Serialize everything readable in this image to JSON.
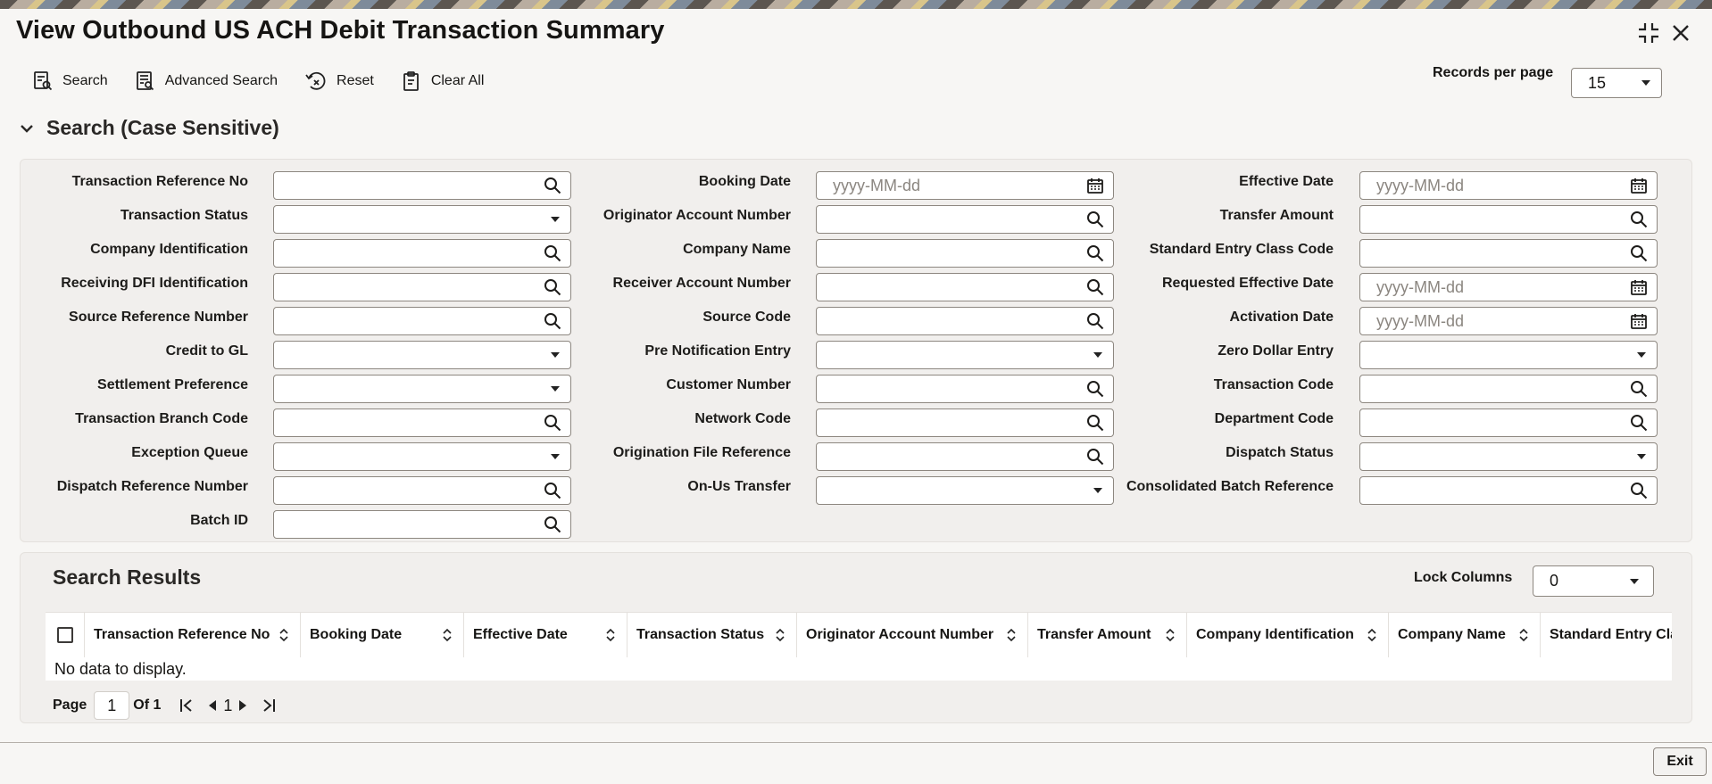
{
  "window": {
    "title": "View Outbound US ACH Debit Transaction Summary"
  },
  "toolbar": {
    "search": "Search",
    "advanced_search": "Advanced Search",
    "reset": "Reset",
    "clear_all": "Clear All",
    "records_per_page_label": "Records per page",
    "records_per_page_value": "15"
  },
  "search_section": {
    "title": "Search (Case Sensitive)"
  },
  "fields": {
    "transaction_reference_no": {
      "label": "Transaction Reference No"
    },
    "transaction_status": {
      "label": "Transaction Status"
    },
    "company_identification": {
      "label": "Company Identification"
    },
    "receiving_dfi_identification": {
      "label": "Receiving DFI Identification"
    },
    "source_reference_number": {
      "label": "Source Reference Number"
    },
    "credit_to_gl": {
      "label": "Credit to GL"
    },
    "settlement_preference": {
      "label": "Settlement Preference"
    },
    "transaction_branch_code": {
      "label": "Transaction Branch Code"
    },
    "exception_queue": {
      "label": "Exception Queue"
    },
    "dispatch_reference_number": {
      "label": "Dispatch Reference Number"
    },
    "batch_id": {
      "label": "Batch ID"
    },
    "booking_date": {
      "label": "Booking Date",
      "placeholder": "yyyy-MM-dd"
    },
    "originator_account_number": {
      "label": "Originator Account Number"
    },
    "company_name": {
      "label": "Company Name"
    },
    "receiver_account_number": {
      "label": "Receiver Account Number"
    },
    "source_code": {
      "label": "Source Code"
    },
    "pre_notification_entry": {
      "label": "Pre Notification Entry"
    },
    "customer_number": {
      "label": "Customer Number"
    },
    "network_code": {
      "label": "Network Code"
    },
    "origination_file_reference": {
      "label": "Origination File Reference"
    },
    "on_us_transfer": {
      "label": "On-Us Transfer"
    },
    "effective_date": {
      "label": "Effective Date",
      "placeholder": "yyyy-MM-dd"
    },
    "transfer_amount": {
      "label": "Transfer Amount"
    },
    "standard_entry_class_code": {
      "label": "Standard Entry Class Code"
    },
    "requested_effective_date": {
      "label": "Requested Effective Date",
      "placeholder": "yyyy-MM-dd"
    },
    "activation_date": {
      "label": "Activation Date",
      "placeholder": "yyyy-MM-dd"
    },
    "zero_dollar_entry": {
      "label": "Zero Dollar Entry"
    },
    "transaction_code": {
      "label": "Transaction Code"
    },
    "department_code": {
      "label": "Department Code"
    },
    "dispatch_status": {
      "label": "Dispatch Status"
    },
    "consolidated_batch_reference": {
      "label": "Consolidated Batch Reference"
    }
  },
  "results": {
    "title": "Search Results",
    "lock_columns_label": "Lock Columns",
    "lock_columns_value": "0",
    "columns": [
      "Transaction Reference No",
      "Booking Date",
      "Effective Date",
      "Transaction Status",
      "Originator Account Number",
      "Transfer Amount",
      "Company Identification",
      "Company Name",
      "Standard Entry Cla"
    ],
    "empty_message": "No data to display.",
    "pagination": {
      "page_label": "Page",
      "current_page": "1",
      "of_label": "Of 1",
      "page_number": "1"
    }
  },
  "footer": {
    "exit": "Exit"
  },
  "icons": [
    "search-doc-icon",
    "advanced-search-icon",
    "reset-icon",
    "clear-all-icon",
    "magnifier-icon",
    "calendar-icon",
    "chevron-down-icon",
    "sort-icon",
    "first-page-icon",
    "prev-page-icon",
    "next-page-icon",
    "last-page-icon",
    "collapse-icon",
    "close-icon"
  ]
}
